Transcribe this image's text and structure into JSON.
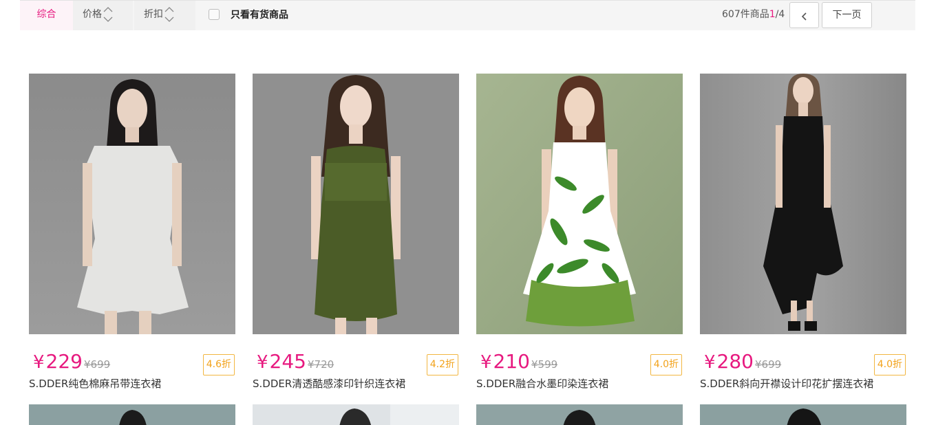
{
  "toolbar": {
    "sort_tabs": [
      {
        "label": "综合",
        "active": true
      },
      {
        "label": "价格",
        "active": false
      },
      {
        "label": "折扣",
        "active": false
      }
    ],
    "in_stock_label": "只看有货商品",
    "in_stock_checked": false,
    "pager": {
      "count_text": "607件商品",
      "current_page": "1",
      "separator": "/",
      "total_pages": "4",
      "prev_icon": "chevron-left-icon",
      "next_label": "下一页"
    }
  },
  "products": [
    {
      "price": "229",
      "currency": "¥",
      "original_price": "¥699",
      "discount": "4.6折",
      "name": "S.DDER纯色棉麻吊带连衣裙",
      "dress_color": "#e4e4e2"
    },
    {
      "price": "245",
      "currency": "¥",
      "original_price": "¥720",
      "discount": "4.2折",
      "name": "S.DDER清透酷感漆印针织连衣裙",
      "dress_color": "#4b5c27"
    },
    {
      "price": "210",
      "currency": "¥",
      "original_price": "¥599",
      "discount": "4.0折",
      "name": "S.DDER融合水墨印染连衣裙",
      "dress_color": "#ffffff"
    },
    {
      "price": "280",
      "currency": "¥",
      "original_price": "¥699",
      "discount": "4.0折",
      "name": "S.DDER斜向开襟设计印花扩摆连衣裙",
      "dress_color": "#141414"
    }
  ],
  "colors": {
    "accent": "#e7197f",
    "discount_border": "#f2b640",
    "photo_bg_grey": "#8a8a8a",
    "photo_bg_green": "#9fae8a"
  }
}
